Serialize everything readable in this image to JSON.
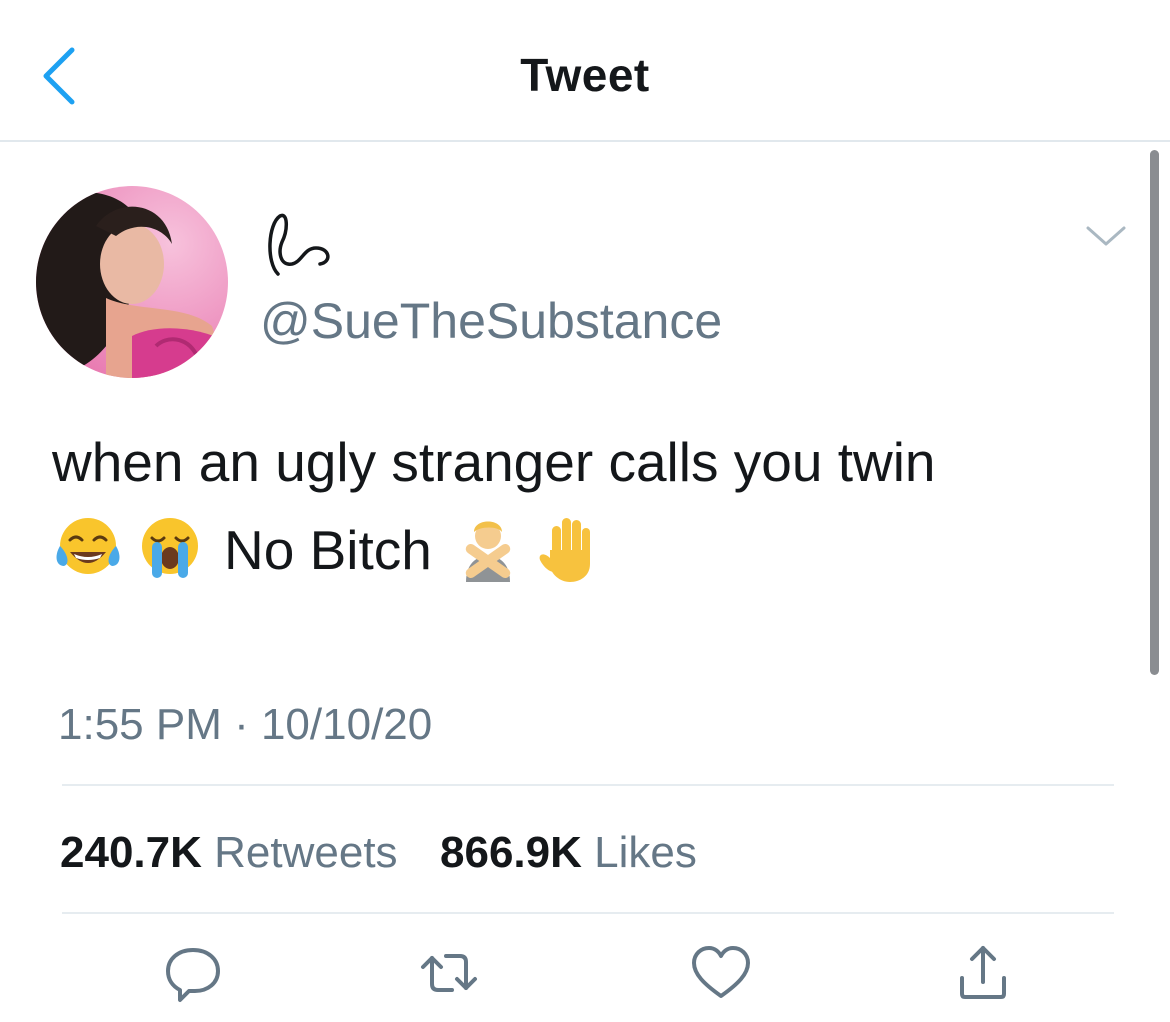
{
  "header": {
    "title": "Tweet",
    "back_icon": "chevron-left-icon"
  },
  "tweet": {
    "display_name_icon": "handwritten-scribble-name",
    "handle": "@SueTheSubstance",
    "line1": "when an ugly stranger calls you twin",
    "line2_emojis_before": [
      "face-with-tears-of-joy-emoji",
      "loudly-crying-face-emoji"
    ],
    "line2_text": "No Bitch",
    "line2_emojis_after": [
      "person-gesturing-no-emoji",
      "raised-hand-emoji"
    ],
    "timestamp": "1:55 PM · 10/10/20"
  },
  "stats": {
    "retweets_count": "240.7K",
    "retweets_label": "Retweets",
    "likes_count": "866.9K",
    "likes_label": "Likes"
  },
  "actions": [
    "reply-icon",
    "retweet-icon",
    "like-icon",
    "share-icon"
  ],
  "colors": {
    "accent": "#1da1f2",
    "secondary_text": "#657786",
    "icon_gray": "#657786",
    "divider": "#e6ecf0"
  }
}
